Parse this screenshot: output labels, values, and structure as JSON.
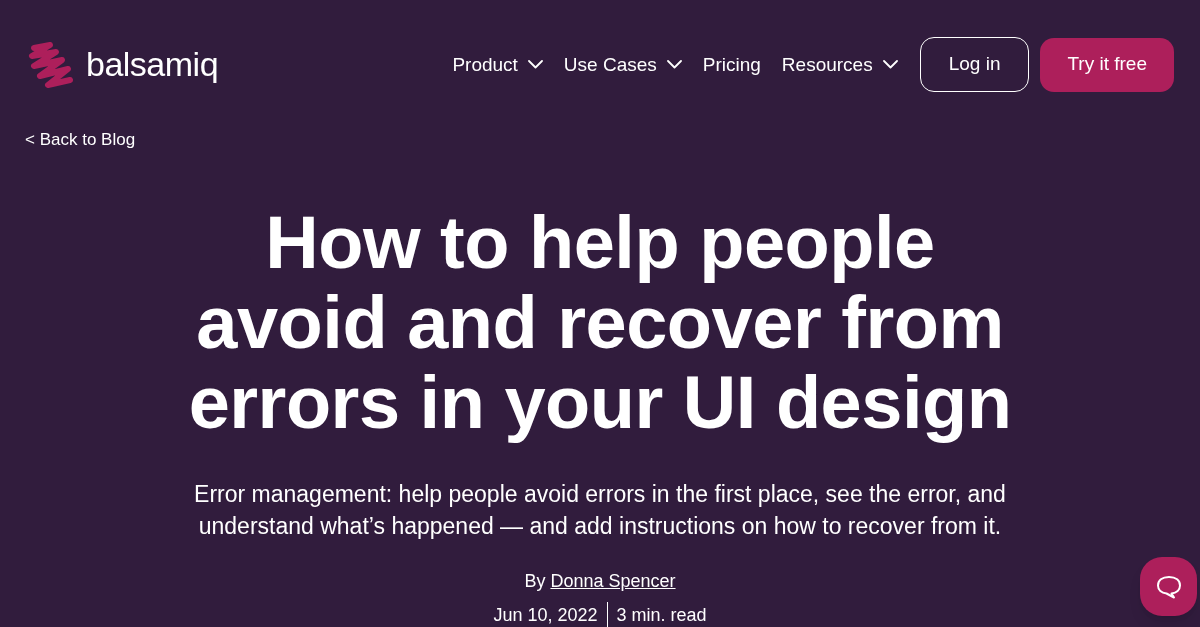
{
  "header": {
    "logo": {
      "text": "balsamiq"
    },
    "nav": [
      {
        "label": "Product",
        "has_menu": true
      },
      {
        "label": "Use Cases",
        "has_menu": true
      },
      {
        "label": "Pricing",
        "has_menu": false
      },
      {
        "label": "Resources",
        "has_menu": true
      }
    ],
    "buttons": [
      {
        "label": "Log in",
        "kind": "outline"
      },
      {
        "label": "Try it free",
        "kind": "primary"
      }
    ]
  },
  "back_link": "< Back to Blog",
  "article": {
    "title": [
      "How to help people",
      "avoid and recover from",
      "errors in your UI design"
    ],
    "summary": [
      "Error management: help people avoid errors in the first place, see the error, and",
      "understand what’s happened — and add instructions on how to recover from it."
    ],
    "byline": {
      "prefix": "By",
      "author": "Donna Spencer"
    },
    "date": "Jun 10, 2022",
    "read_time": "3 min. read"
  }
}
